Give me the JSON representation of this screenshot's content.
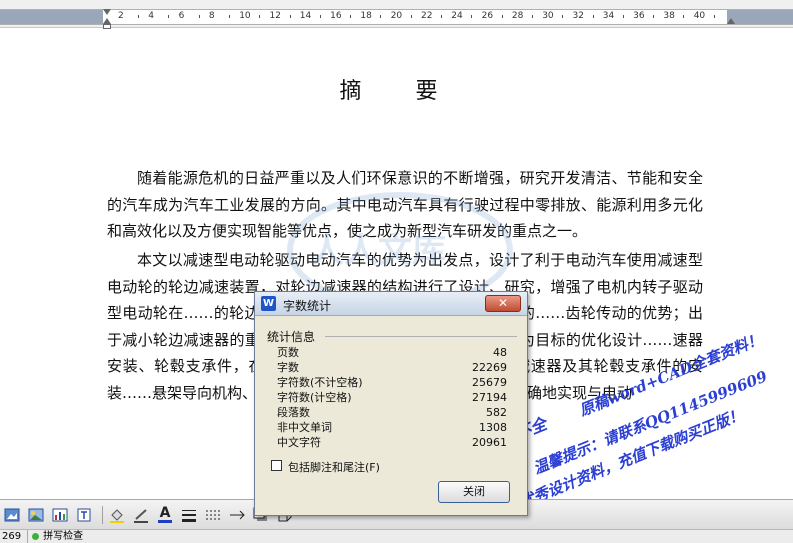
{
  "ruler": {
    "numbers": [
      "2",
      "4",
      "6",
      "8",
      "10",
      "12",
      "14",
      "16",
      "18",
      "20",
      "22",
      "24",
      "26",
      "28",
      "30",
      "32",
      "34",
      "36",
      "38",
      "40"
    ]
  },
  "document": {
    "title": "摘　要",
    "paragraph1": "随着能源危机的日益严重以及人们环保意识的不断增强，研究开发清洁、节能和安全的汽车成为汽车工业发展的方向。其中电动汽车具有行驶过程中零排放、能源利用多元化和高效化以及方便实现智能等优点，使之成为新型汽车研发的重点之一。",
    "paragraph2": "本文以减速型电动轮驱动电动汽车的优势为出发点，设计了利于电动汽车使用减速型电动轮的轮边减速装置，对轮边减速器的结构进行了设计、研究，增强了电机内转子驱动型电动轮在……的轮边减速器的减速传动形式，在减速传动链的……齿轮传动的优势；出于减小轮边减速器的重量……器的行星传动系统进行了以体积为目标的优化设计……速器安装、轮毂支承件，在满足功能的前提下……的巧妙设计使减速器及其轮毂支承件的安装……悬架导向机构、转向拉杆及横向稳定杆提供了……能够精确地实现与电动"
  },
  "watermark": {
    "site_text": "www.renrendoc.com",
    "line1": "预览稿内容不全",
    "line2": "原稿word+CAD全套资料！",
    "line3": "温馨提示：请联系QQ1145999609",
    "line4": "优秀设计资料，充值下载购买正版！"
  },
  "toolbar": {
    "items": [
      "insert-image-icon",
      "insert-picture-icon",
      "insert-chart-icon",
      "insert-textbox-icon",
      "fill-color-icon",
      "line-color-icon",
      "font-color-icon",
      "line-style-icon",
      "dash-style-icon",
      "arrow-style-icon",
      "shadow-icon",
      "3d-icon"
    ],
    "font_color_letter": "A"
  },
  "statusbar": {
    "page_count": "269",
    "spell_check": "拼写检查"
  },
  "dialog": {
    "title": "字数统计",
    "group_label": "统计信息",
    "stats": [
      {
        "label": "页数",
        "value": "48"
      },
      {
        "label": "字数",
        "value": "22269"
      },
      {
        "label": "字符数(不计空格)",
        "value": "25679"
      },
      {
        "label": "字符数(计空格)",
        "value": "27194"
      },
      {
        "label": "段落数",
        "value": "582"
      },
      {
        "label": "非中文单词",
        "value": "1308"
      },
      {
        "label": "中文字符",
        "value": "20961"
      }
    ],
    "checkbox_label": "包括脚注和尾注(F)",
    "close_button": "关闭",
    "close_x": "✕",
    "app_icon_letter": "W"
  },
  "colors": {
    "watermark_blue": "#2b3fd4",
    "dialog_bg": "#ece9d8"
  }
}
